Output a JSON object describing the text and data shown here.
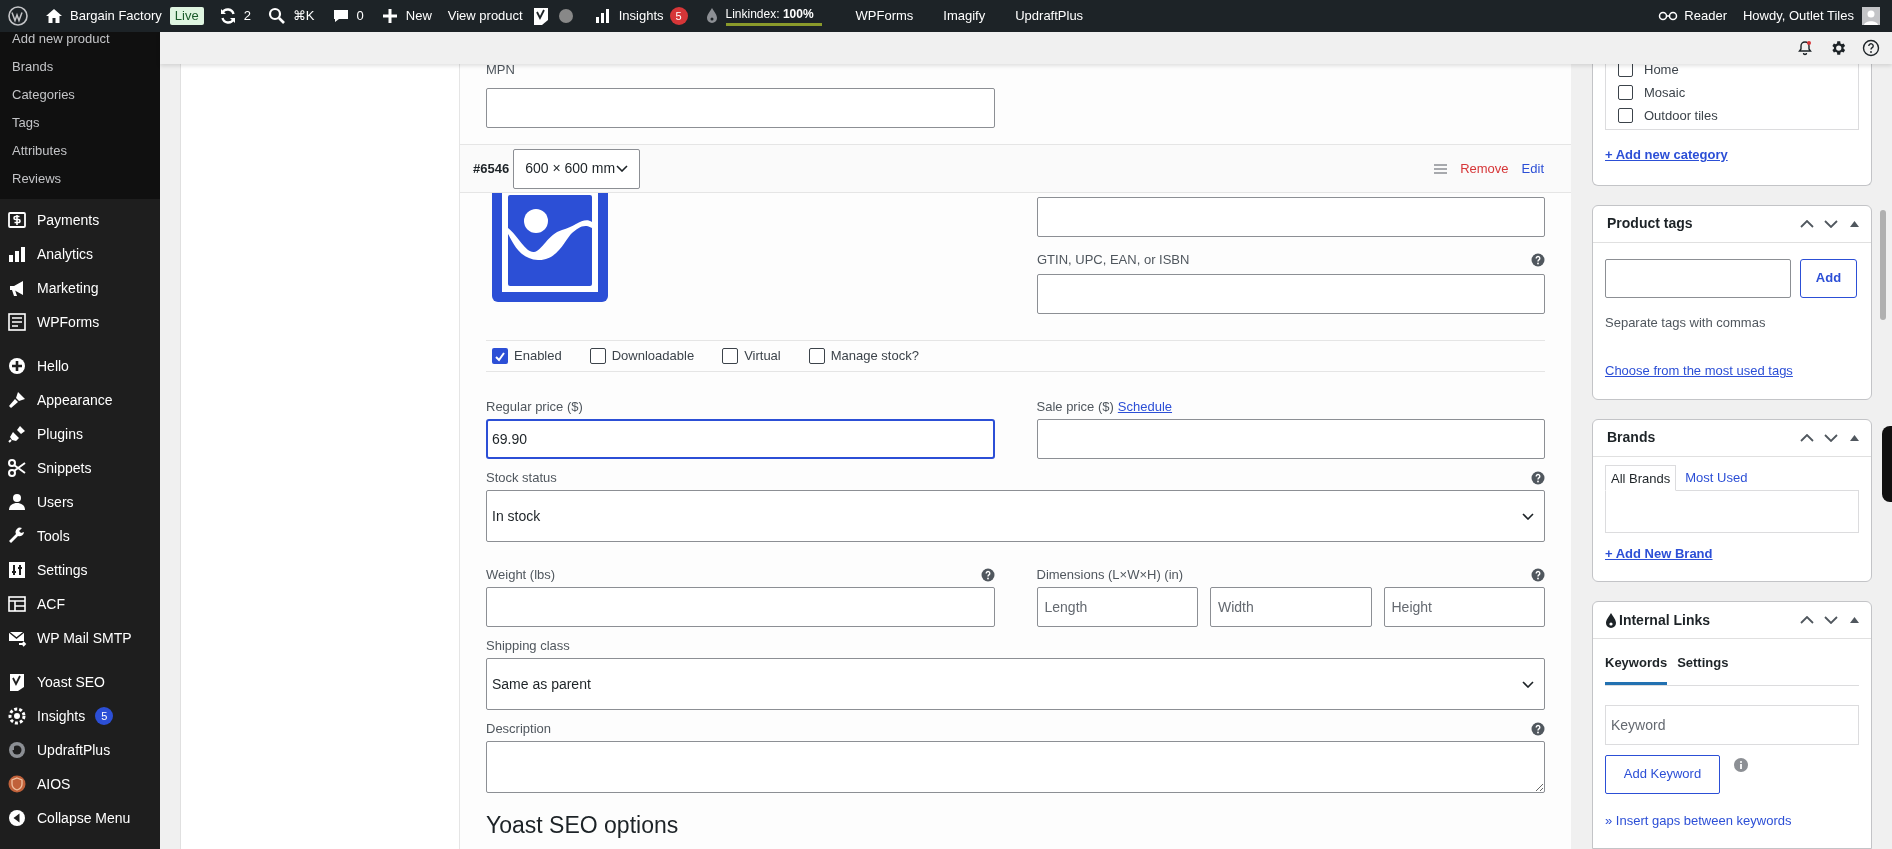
{
  "admin_bar": {
    "site": "Bargain Factory",
    "environment": "Live",
    "updates": "2",
    "search_shortcut": "⌘K",
    "comments": "0",
    "new": "New",
    "view": "View product",
    "insights": {
      "label": "Insights",
      "count": "5"
    },
    "linkindex": {
      "text": "Linkindex: **100%**",
      "level": 1
    },
    "links": [
      "WPForms",
      "Imagify",
      "UpdraftPlus"
    ],
    "reader": "Reader",
    "greeting": "Howdy, Outlet Tiles"
  },
  "sidebar": {
    "submenu": [
      "Add new product",
      "Brands",
      "Categories",
      "Tags",
      "Attributes",
      "Reviews"
    ],
    "groups": [
      [
        {
          "label": "Payments"
        },
        {
          "label": "Analytics"
        },
        {
          "label": "Marketing"
        },
        {
          "label": "WPForms"
        }
      ],
      [
        {
          "label": "Hello"
        },
        {
          "label": "Appearance"
        },
        {
          "label": "Plugins"
        },
        {
          "label": "Snippets"
        },
        {
          "label": "Users"
        },
        {
          "label": "Tools"
        },
        {
          "label": "Settings"
        },
        {
          "label": "ACF"
        },
        {
          "label": "WP Mail SMTP"
        }
      ],
      [
        {
          "label": "Yoast SEO"
        },
        {
          "label": "Insights",
          "badge": "5"
        },
        {
          "label": "UpdraftPlus"
        },
        {
          "label": "AIOS"
        },
        {
          "label": "Collapse Menu"
        }
      ]
    ]
  },
  "top_field": {
    "label": "MPN"
  },
  "variation": {
    "number": "#6546",
    "attribute": "600 × 600 mm",
    "actions": [
      {
        "label": "Remove",
        "kind": "danger"
      },
      {
        "label": "Edit",
        "kind": "link"
      }
    ],
    "image_fields": [
      {
        "help": false
      },
      {
        "label": "GTIN, UPC, EAN, or ISBN",
        "help": true
      }
    ],
    "checkboxes": [
      {
        "label": "Enabled",
        "checked": true
      },
      {
        "label": "Downloadable",
        "checked": false
      },
      {
        "label": "Virtual",
        "checked": false
      },
      {
        "label": "Manage stock?",
        "checked": false
      }
    ],
    "rows": [
      [
        {
          "kind": "text",
          "label": "Regular price ($)",
          "value": "69.90",
          "focused": true,
          "help": false
        },
        {
          "kind": "text",
          "label": "Sale price ($)",
          "link": "Schedule",
          "focused": false,
          "help": false
        }
      ],
      [
        {
          "kind": "select",
          "label": "Stock status",
          "value": "In stock",
          "focused": false,
          "help": true
        }
      ],
      [
        {
          "kind": "text",
          "label": "Weight (lbs)",
          "focused": false,
          "help": true
        },
        {
          "kind": "dimensions",
          "label": "Dimensions (L×W×H) (in)",
          "placeholders": [
            "Length",
            "Width",
            "Height"
          ],
          "focused": false,
          "help": true
        }
      ],
      [
        {
          "kind": "select",
          "label": "Shipping class",
          "value": "Same as parent",
          "focused": false,
          "help": false
        }
      ],
      [
        {
          "kind": "textarea",
          "label": "Description",
          "focused": false,
          "help": true
        }
      ]
    ]
  },
  "section_heading": "Yoast SEO options",
  "categories_box": {
    "items": [
      {
        "label": "Home",
        "checked": false
      },
      {
        "label": "Mosaic",
        "checked": false
      },
      {
        "label": "Outdoor tiles",
        "checked": false
      }
    ],
    "link": "+ Add new category"
  },
  "tags_box": {
    "title": "Product tags",
    "button": "Add",
    "hint": "Separate tags with commas",
    "link": "Choose from the most used tags"
  },
  "brands_box": {
    "title": "Brands",
    "tabs": [
      {
        "label": "All Brands",
        "selected": true
      },
      {
        "label": "Most Used",
        "selected": false
      }
    ],
    "link": "+ Add New Brand"
  },
  "links_box": {
    "title": "Internal Links",
    "tabs": [
      {
        "label": "Keywords",
        "selected": true
      },
      {
        "label": "Settings",
        "selected": false
      }
    ],
    "placeholder": "Keyword",
    "button": "Add Keyword",
    "link": "» Insert gaps between keywords"
  }
}
